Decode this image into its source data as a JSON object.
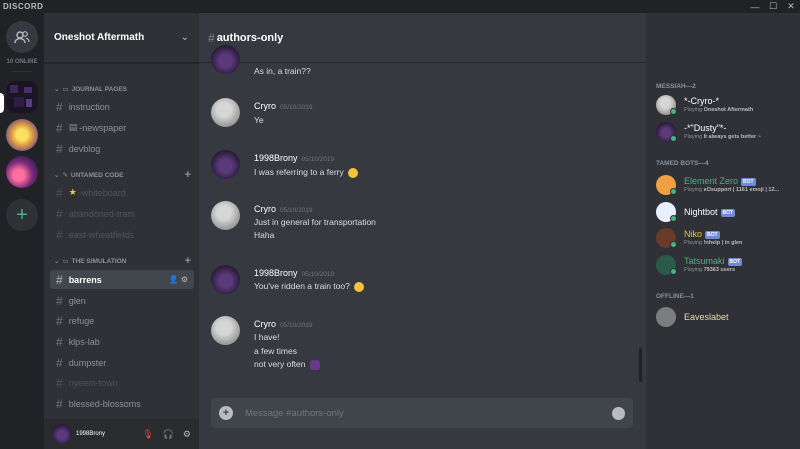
{
  "app": {
    "brand": "DISCORD"
  },
  "servers": {
    "online_label": "10 ONLINE"
  },
  "guild": {
    "name": "Oneshot Aftermath"
  },
  "sidebar": {
    "categories": [
      {
        "label": "JOURNAL PAGES"
      },
      {
        "label": "UNTAMED CODE"
      },
      {
        "label": "THE SIMULATION"
      }
    ],
    "channels": [
      {
        "label": "instruction"
      },
      {
        "label": "-newspaper"
      },
      {
        "label": "devblog"
      },
      {
        "label": "-whiteboard"
      },
      {
        "label": "abandoned-tram"
      },
      {
        "label": "east-wheatfields"
      },
      {
        "label": "barrens"
      },
      {
        "label": "glen"
      },
      {
        "label": "refuge"
      },
      {
        "label": "klps-lab"
      },
      {
        "label": "dumpster"
      },
      {
        "label": "nyeem-town"
      },
      {
        "label": "blessed-blossoms"
      }
    ]
  },
  "user": {
    "name": "1998Brony"
  },
  "chat": {
    "channel": "authors-only",
    "messages": [
      {
        "lines": [
          "As in, a train??"
        ]
      },
      {
        "author": "Cryro",
        "timestamp": "05/10/2019",
        "lines": [
          "Ye"
        ]
      },
      {
        "author": "1998Brony",
        "timestamp": "05/10/2019",
        "lines": [
          "I was referring to a ferry"
        ]
      },
      {
        "author": "Cryro",
        "timestamp": "05/10/2019",
        "lines": [
          "Just in general for transportation",
          "Haha"
        ]
      },
      {
        "author": "1998Brony",
        "timestamp": "05/10/2019",
        "lines": [
          "You've ridden a train too?"
        ]
      },
      {
        "author": "Cryro",
        "timestamp": "05/10/2019",
        "lines": [
          "I have!",
          "a few times",
          "not very often"
        ]
      }
    ],
    "composer_placeholder": "Message #authors-only"
  },
  "members": {
    "groups": [
      {
        "label": "MESSIAH—2"
      },
      {
        "label": "TAMED BOTS—4"
      },
      {
        "label": "OFFLINE—1"
      }
    ],
    "list": [
      {
        "name": "*-Cryro-*",
        "activity_prefix": "Playing ",
        "activity": "Oneshot Aftermath",
        "color": "#ffffff"
      },
      {
        "name": "-*\"Dusty\"*-",
        "activity_prefix": "Playing ",
        "activity": "It always gets better ~",
        "color": "#ffffff"
      },
      {
        "name": "Element Zero",
        "activity_prefix": "Playing ",
        "activity": "eOsupport | 1161 emoji | 12...",
        "color": "#43b581",
        "bot": "BOT"
      },
      {
        "name": "Nightbot",
        "color": "#ffffff",
        "bot": "BOT"
      },
      {
        "name": "Niko",
        "activity_prefix": "Playing ",
        "activity": "!nhelp | in glen",
        "color": "#f0c040",
        "bot": "BOT"
      },
      {
        "name": "Tatsumaki",
        "activity_prefix": "Playing ",
        "activity": "79363 users",
        "color": "#43b581",
        "bot": "BOT"
      },
      {
        "name": "Eaveslabet",
        "color": "#8e9297"
      }
    ]
  },
  "colors": {
    "accent": "#7289da",
    "online": "#43b581",
    "muted_mic": "#f04747"
  }
}
